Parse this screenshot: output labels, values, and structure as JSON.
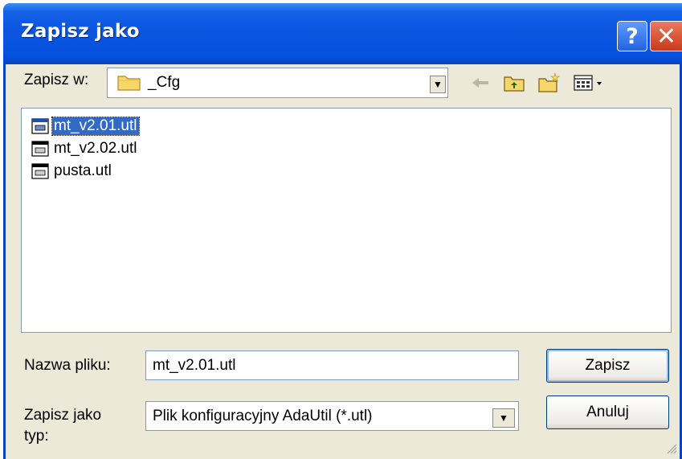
{
  "window": {
    "title": "Zapisz jako"
  },
  "lookin": {
    "label": "Zapisz w:",
    "value": "_Cfg"
  },
  "files": [
    {
      "name": "mt_v2.01.utl",
      "selected": true
    },
    {
      "name": "mt_v2.02.utl",
      "selected": false
    },
    {
      "name": "pusta.utl",
      "selected": false
    }
  ],
  "filename": {
    "label": "Nazwa pliku:",
    "value": "mt_v2.01.utl"
  },
  "filetype": {
    "label": "Zapisz jako typ:",
    "value": "Plik konfiguracyjny AdaUtil (*.utl)"
  },
  "buttons": {
    "save": "Zapisz",
    "cancel": "Anuluj",
    "help": "?",
    "close": "✕"
  },
  "icons": {
    "folder": "folder-icon",
    "back": "back-arrow-icon",
    "up": "up-folder-icon",
    "new_folder": "new-folder-icon",
    "view": "view-menu-icon",
    "file": "utl-file-icon"
  }
}
